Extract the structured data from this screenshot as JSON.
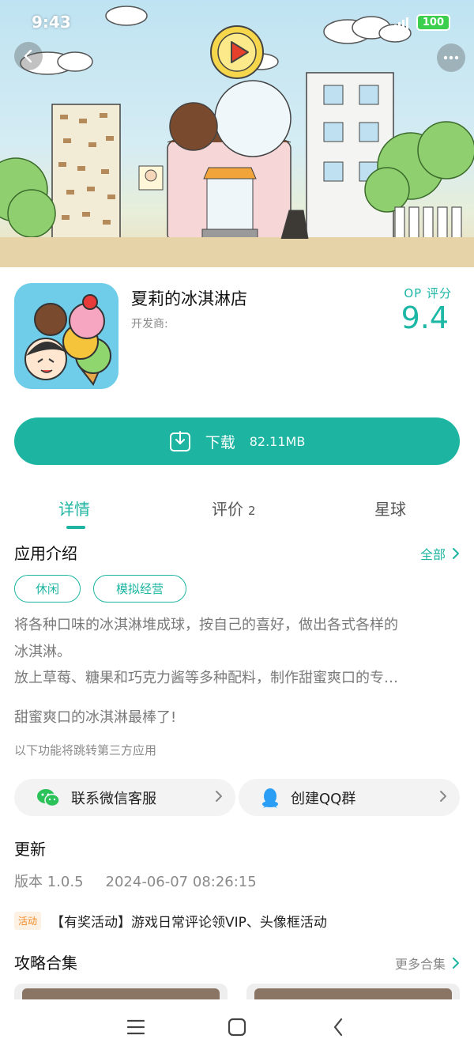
{
  "status_bar": {
    "time": "9:43",
    "battery": "100"
  },
  "app": {
    "name": "夏莉的冰淇淋店",
    "developer_label": "开发商:",
    "rating_label": "OP 评分",
    "rating_value": "9.4"
  },
  "download": {
    "label": "下载",
    "size": "82.11MB"
  },
  "tabs": [
    {
      "label": "详情",
      "count": ""
    },
    {
      "label": "评价",
      "count": "2"
    },
    {
      "label": "星球",
      "count": ""
    }
  ],
  "intro": {
    "title": "应用介绍",
    "more_label": "全部",
    "tags": [
      "休闲",
      "模拟经营"
    ],
    "lines": [
      "将各种口味的冰淇淋堆成球，按自己的喜好，做出各式各样的",
      "冰淇淋。",
      "放上草莓、糖果和巧克力酱等多种配料，制作甜蜜爽口的专…",
      "甜蜜爽口的冰淇淋最棒了!"
    ],
    "third_party_note": "以下功能将跳转第三方应用"
  },
  "actions": [
    {
      "label": "联系微信客服",
      "icon": "wechat-icon"
    },
    {
      "label": "创建QQ群",
      "icon": "qq-icon"
    }
  ],
  "update": {
    "title": "更新",
    "version": "版本 1.0.5",
    "datetime": "2024-06-07 08:26:15"
  },
  "activity": {
    "badge": "活动",
    "text": "【有奖活动】游戏日常评论领VIP、头像框活动"
  },
  "guides": {
    "title": "攻略合集",
    "more_label": "更多合集"
  },
  "colors": {
    "accent": "#1db5a1",
    "badge_orange": "#f08a24",
    "score": "#1db7a6"
  }
}
